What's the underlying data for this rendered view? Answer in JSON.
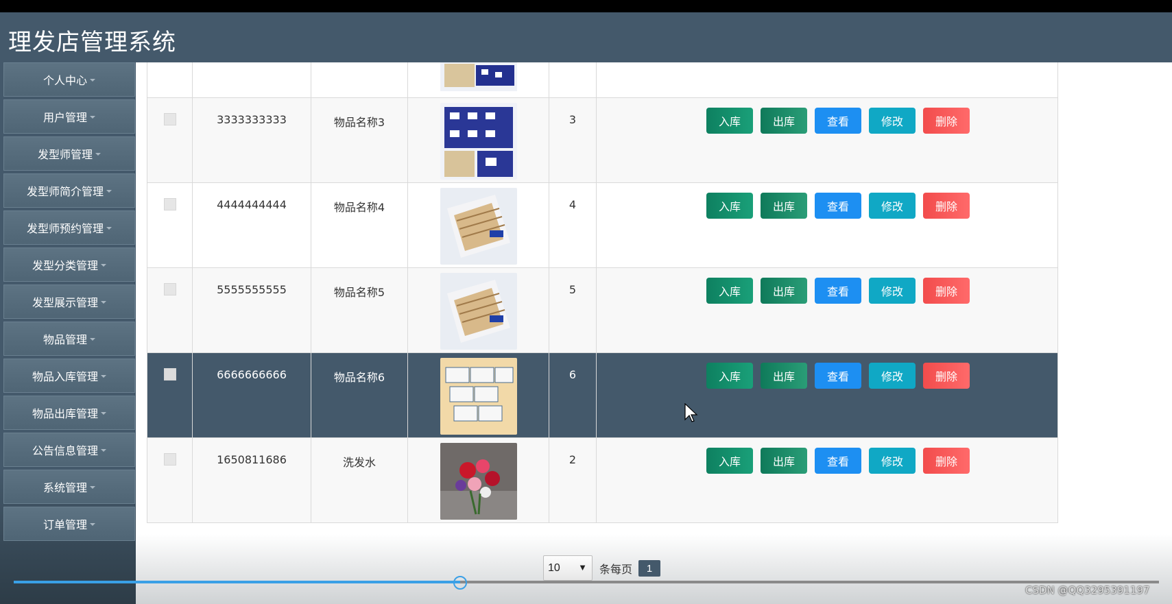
{
  "app": {
    "title": "理发店管理系统"
  },
  "sidebar": {
    "items": [
      {
        "label": "个人中心"
      },
      {
        "label": "用户管理"
      },
      {
        "label": "发型师管理"
      },
      {
        "label": "发型师简介管理"
      },
      {
        "label": "发型师预约管理"
      },
      {
        "label": "发型分类管理"
      },
      {
        "label": "发型展示管理"
      },
      {
        "label": "物品管理"
      },
      {
        "label": "物品入库管理"
      },
      {
        "label": "物品出库管理"
      },
      {
        "label": "公告信息管理"
      },
      {
        "label": "系统管理"
      },
      {
        "label": "订单管理"
      }
    ]
  },
  "table": {
    "actions": {
      "stock_in": "入库",
      "stock_out": "出库",
      "view": "查看",
      "edit": "修改",
      "delete": "删除"
    },
    "rows": [
      {
        "code": "3333333333",
        "name": "物品名称3",
        "qty": "3",
        "image": "tissue-pack-icon"
      },
      {
        "code": "4444444444",
        "name": "物品名称4",
        "qty": "4",
        "image": "cotton-swab-pack-icon"
      },
      {
        "code": "5555555555",
        "name": "物品名称5",
        "qty": "5",
        "image": "cotton-swab-pack-icon"
      },
      {
        "code": "6666666666",
        "name": "物品名称6",
        "qty": "6",
        "image": "tissue-boxes-icon"
      },
      {
        "code": "1650811686",
        "name": "洗发水",
        "qty": "2",
        "image": "flower-bouquet-icon"
      }
    ]
  },
  "pagination": {
    "page_size": "10",
    "per_page_label": "条每页",
    "current_page": "1"
  },
  "video": {
    "progress": 0.39
  },
  "watermark": "CSDN @QQ3295391197"
}
